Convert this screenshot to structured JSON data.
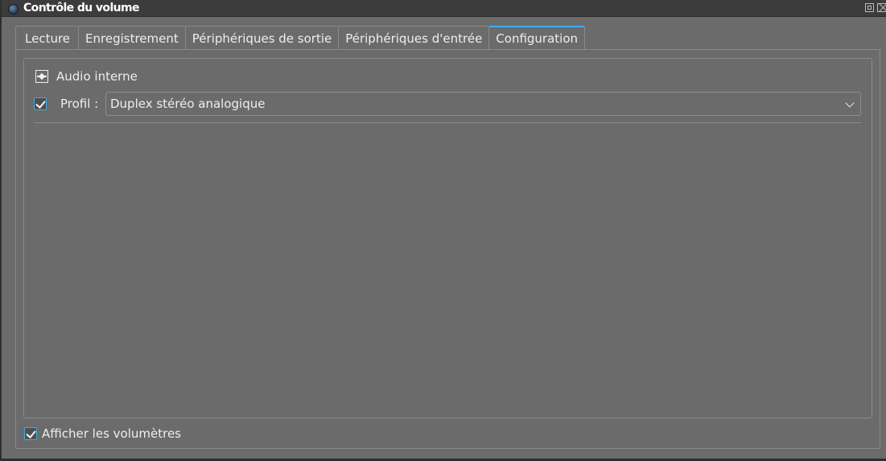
{
  "window": {
    "title": "Contrôle du volume",
    "app_icon": "pavucontrol-icon",
    "buttons": [
      "maximize-icon",
      "close-icon"
    ]
  },
  "tabs": [
    {
      "label": "Lecture",
      "active": false
    },
    {
      "label": "Enregistrement",
      "active": false
    },
    {
      "label": "Périphériques de sortie",
      "active": false
    },
    {
      "label": "Périphériques d'entrée",
      "active": false
    },
    {
      "label": "Configuration",
      "active": true
    }
  ],
  "card": {
    "icon": "audio-card-icon",
    "name": "Audio interne",
    "profile_enabled": true,
    "profile_label": "Profil :",
    "profile_value": "Duplex stéréo analogique"
  },
  "footer": {
    "show_meters_checked": true,
    "show_meters_label": "Afficher les volumètres"
  },
  "colors": {
    "background": "#6b6b6b",
    "titlebar": "#3c3c3c",
    "accent": "#3daee9",
    "border": "#8a8a8a",
    "text": "#eeeeee"
  }
}
